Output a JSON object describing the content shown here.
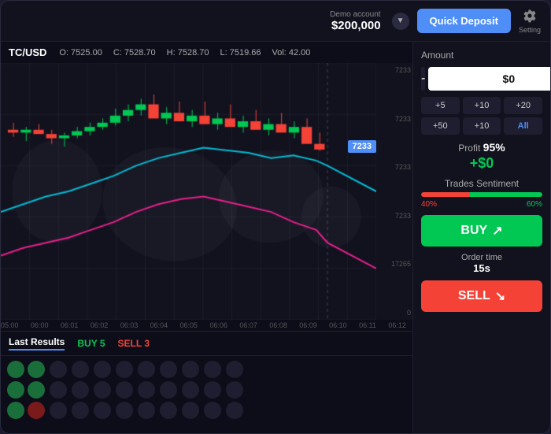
{
  "header": {
    "demo_label": "Demo account",
    "demo_amount": "$200,000",
    "quick_deposit_label": "Quick Deposit",
    "settings_label": "Setting"
  },
  "chart": {
    "pair": "TC/USD",
    "stats": {
      "open": "O: 7525.00",
      "close": "C: 7528.70",
      "high": "H: 7528.70",
      "low": "L: 7519.66",
      "vol": "Vol: 42.00"
    },
    "current_price": "7233",
    "price_ticks": [
      "7233",
      "7233",
      "7233",
      "7233",
      "17265",
      "0"
    ],
    "time_labels": [
      "05:00",
      "06:00",
      "06:01",
      "06:02",
      "06:03",
      "06:04",
      "06:05",
      "06:06",
      "06:07",
      "06:08",
      "06:09",
      "06:10",
      "06:11",
      "06:12"
    ]
  },
  "right_panel": {
    "amount_label": "Amount",
    "minus_label": "-",
    "plus_label": "+",
    "amount_value": "$0",
    "quick_amounts": [
      "+5",
      "+10",
      "+20",
      "+50",
      "+10",
      "All"
    ],
    "profit_label": "Profit",
    "profit_pct": "95%",
    "profit_value": "+$0",
    "sentiment_label": "Trades Sentiment",
    "sentiment_red_pct": "40%",
    "sentiment_green_pct": "60%",
    "buy_label": "BUY",
    "order_time_label": "Order time",
    "order_time_value": "15s",
    "sell_label": "SELL"
  },
  "bottom": {
    "last_results_label": "Last Results",
    "buy_label": "BUY",
    "buy_count": "5",
    "sell_label": "SELL",
    "sell_count": "3",
    "dots": [
      [
        "green",
        "green",
        "dot",
        "dot",
        "dot",
        "dot",
        "dot",
        "dot",
        "dot",
        "dot"
      ],
      [
        "green",
        "green",
        "dot",
        "dot",
        "dot",
        "dot",
        "dot",
        "dot",
        "dot",
        "dot"
      ],
      [
        "green",
        "red",
        "dot",
        "dot",
        "dot",
        "dot",
        "dot",
        "dot",
        "dot",
        "dot"
      ]
    ]
  }
}
